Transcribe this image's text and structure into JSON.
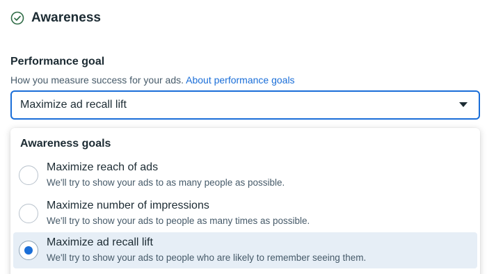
{
  "section": {
    "title": "Awareness",
    "icon": "check-circle-icon",
    "icon_color": "#2e6b45"
  },
  "performance_goal": {
    "label": "Performance goal",
    "help_text": "How you measure success for your ads.",
    "help_link": "About performance goals",
    "selected_value": "Maximize ad recall lift"
  },
  "dropdown": {
    "group_title": "Awareness goals",
    "options": [
      {
        "title": "Maximize reach of ads",
        "description": "We'll try to show your ads to as many people as possible.",
        "selected": false
      },
      {
        "title": "Maximize number of impressions",
        "description": "We'll try to show your ads to people as many times as possible.",
        "selected": false
      },
      {
        "title": "Maximize ad recall lift",
        "description": "We'll try to show your ads to people who are likely to remember seeing them.",
        "selected": true
      }
    ]
  },
  "colors": {
    "accent": "#1a6ed8",
    "selected_row_bg": "#e6eef6",
    "text": "#1c2b33",
    "secondary_text": "#465a69"
  }
}
